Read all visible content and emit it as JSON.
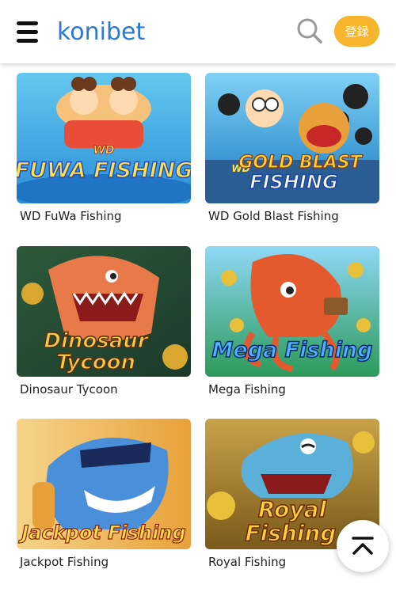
{
  "header": {
    "logo_text": "konibet",
    "login_label": "登録"
  },
  "colors": {
    "brand_blue": "#2b78d6",
    "login_bg": "#f7b52e"
  },
  "icons": {
    "menu": "hamburger-icon",
    "search": "search-icon",
    "back_to_top": "chevron-up-bar-icon"
  },
  "games": [
    {
      "name": "WD FuWa Fishing",
      "art_lines": [
        "WD",
        "FUWA FISHING"
      ]
    },
    {
      "name": "WD Gold Blast Fishing",
      "art_lines": [
        "WD",
        "GOLD BLAST",
        "FISHING"
      ]
    },
    {
      "name": "Dinosaur Tycoon",
      "art_lines": [
        "Dinosaur",
        "Tycoon"
      ]
    },
    {
      "name": "Mega Fishing",
      "art_lines": [
        "Mega Fishing"
      ]
    },
    {
      "name": "Jackpot Fishing",
      "art_lines": [
        "Jackpot Fishing"
      ]
    },
    {
      "name": "Royal Fishing",
      "art_lines": [
        "Royal",
        "Fishing"
      ]
    }
  ]
}
